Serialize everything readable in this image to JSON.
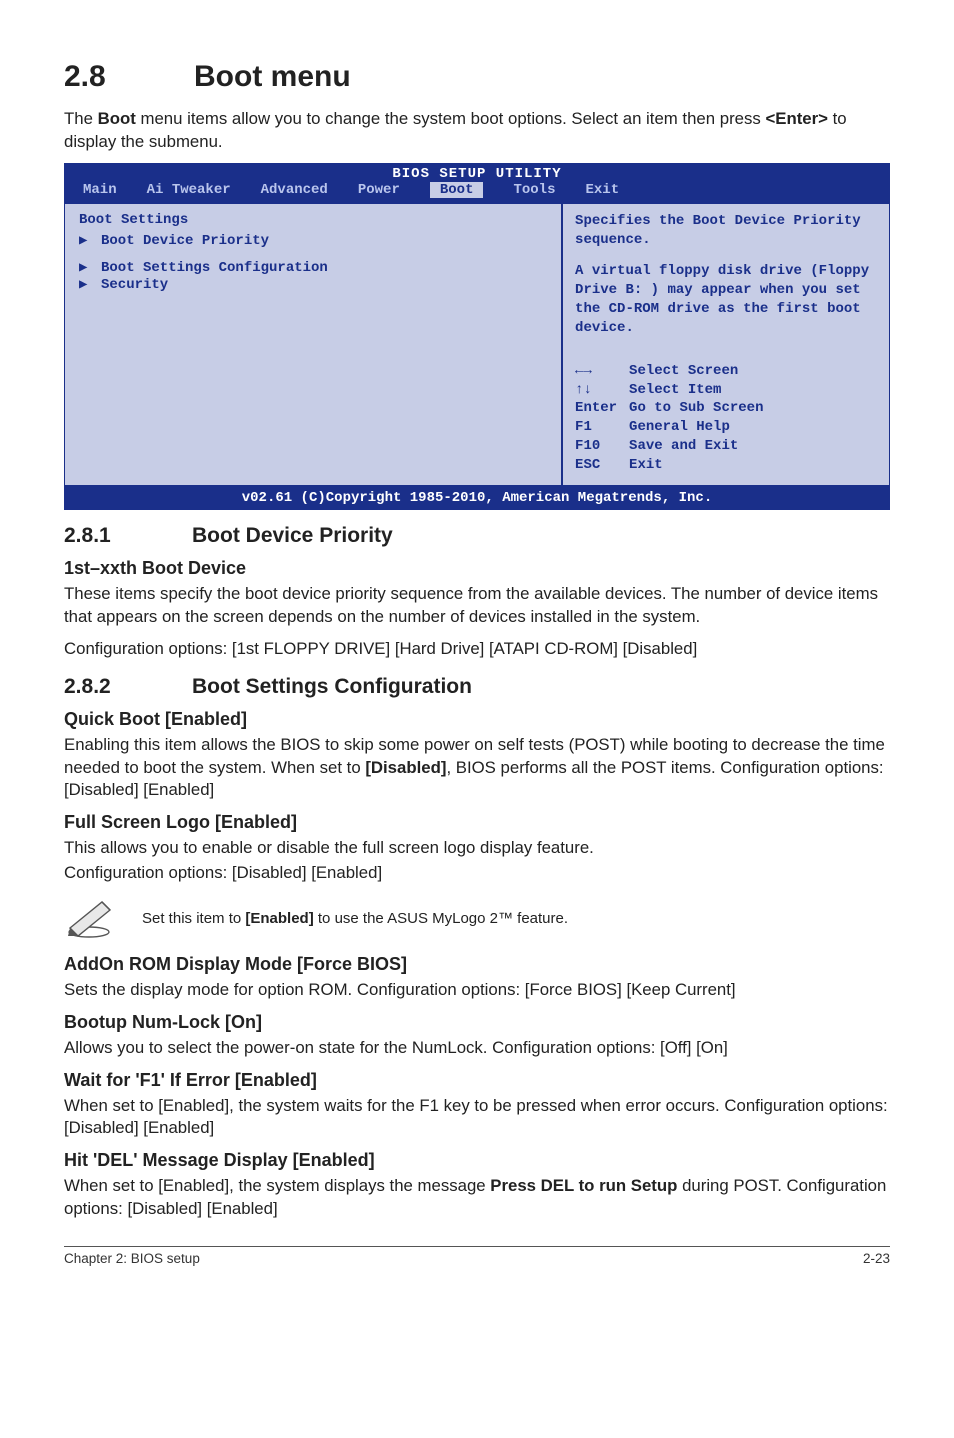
{
  "heading": {
    "number": "2.8",
    "title": "Boot menu"
  },
  "intro": {
    "line1_pre": "The ",
    "line1_bold": "Boot",
    "line1_post": " menu items allow you to change the system boot options. Select an item then press ",
    "line1_bold2": "<Enter>",
    "line1_tail": " to display the submenu."
  },
  "bios": {
    "title": "BIOS SETUP UTILITY",
    "menubar": [
      "Main",
      "Ai Tweaker",
      "Advanced",
      "Power",
      "Boot",
      "Tools",
      "Exit"
    ],
    "active_tab": "Boot",
    "left": {
      "header": "Boot Settings",
      "items": [
        "Boot Device Priority",
        "Boot Settings Configuration",
        "Security"
      ]
    },
    "right": {
      "help": "Specifies the Boot Device Priority sequence.",
      "help2": "A virtual floppy disk drive (Floppy Drive B: ) may appear when you set the CD-ROM drive as the first boot device.",
      "keys": [
        {
          "sym": "←→",
          "label": "Select Screen"
        },
        {
          "sym": "↑↓",
          "label": "Select Item"
        },
        {
          "sym": "Enter",
          "label": "Go to Sub Screen"
        },
        {
          "sym": "F1",
          "label": "General Help"
        },
        {
          "sym": "F10",
          "label": "Save and Exit"
        },
        {
          "sym": "ESC",
          "label": "Exit"
        }
      ]
    },
    "footer": "v02.61 (C)Copyright 1985-2010, American Megatrends, Inc."
  },
  "sec281": {
    "number": "2.8.1",
    "title": "Boot Device Priority",
    "h3": "1st–xxth Boot Device",
    "p1": "These items specify the boot device priority sequence from the available devices. The number of device items that appears on the screen depends on the number of devices installed in the system.",
    "p2": "Configuration options: [1st FLOPPY DRIVE] [Hard Drive] [ATAPI CD-ROM] [Disabled]"
  },
  "sec282": {
    "number": "2.8.2",
    "title": "Boot Settings Configuration",
    "quickboot": {
      "h": "Quick Boot [Enabled]",
      "p_pre": "Enabling this item allows the BIOS to skip some power on self tests (POST) while booting to decrease the time needed to boot the system. When set to ",
      "p_bold": "[Disabled]",
      "p_post": ", BIOS performs all the POST items. Configuration options: [Disabled] [Enabled]"
    },
    "fullscreen": {
      "h": "Full Screen Logo [Enabled]",
      "p1": "This allows you to enable or disable the full screen logo display feature.",
      "p2": "Configuration options: [Disabled] [Enabled]"
    },
    "note_pre": "Set this item to ",
    "note_bold": "[Enabled]",
    "note_post": " to use the ASUS MyLogo 2™ feature.",
    "addon": {
      "h": "AddOn ROM Display Mode [Force BIOS]",
      "p": "Sets the display mode for option ROM. Configuration options: [Force BIOS] [Keep Current]"
    },
    "numlock": {
      "h": "Bootup Num-Lock [On]",
      "p": "Allows you to select the power-on state for the NumLock. Configuration options: [Off] [On]"
    },
    "waitf1": {
      "h": "Wait for 'F1' If Error [Enabled]",
      "p": "When set to [Enabled], the system waits for the F1 key to be pressed when error occurs. Configuration options: [Disabled] [Enabled]"
    },
    "hitdel": {
      "h": "Hit 'DEL' Message Display [Enabled]",
      "p_pre": "When set to [Enabled], the system displays the message ",
      "p_bold": "Press DEL to run Setup",
      "p_post": " during POST. Configuration options: [Disabled] [Enabled]"
    }
  },
  "footer": {
    "left": "Chapter 2: BIOS setup",
    "right": "2-23"
  }
}
